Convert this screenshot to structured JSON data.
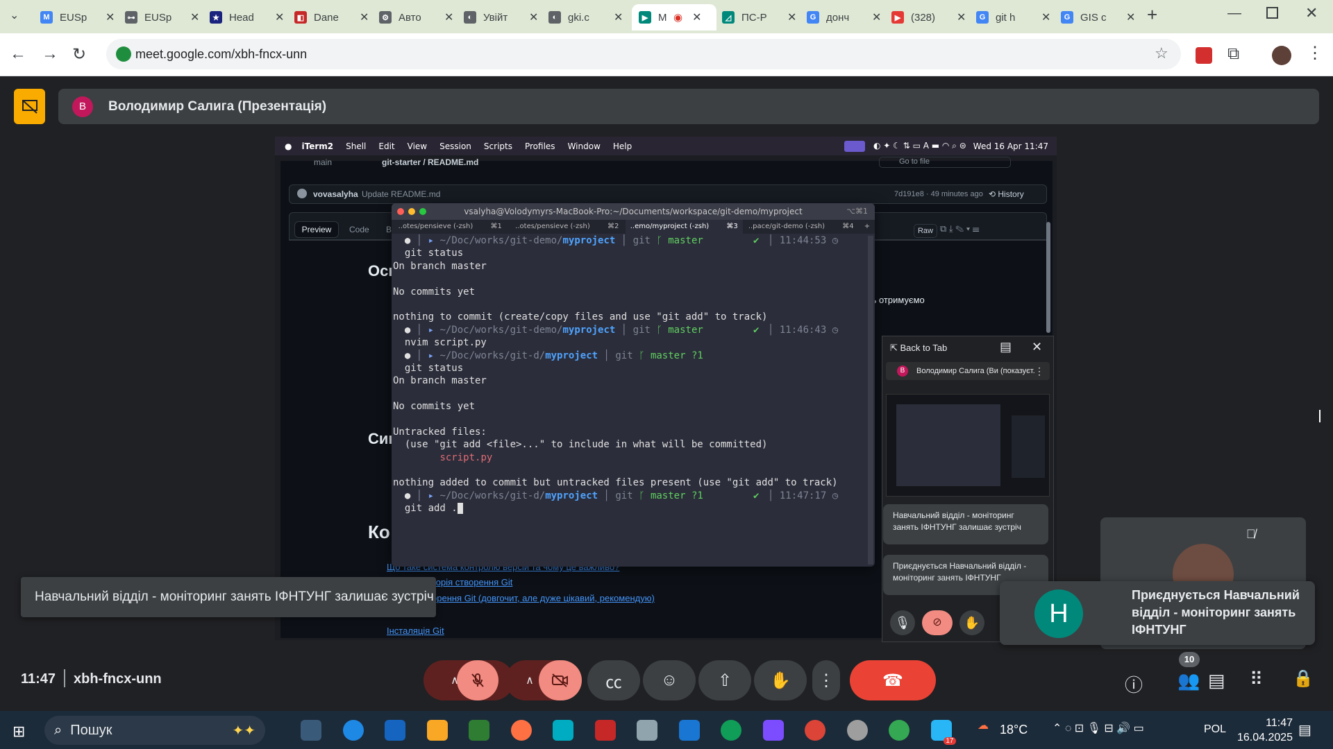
{
  "browser": {
    "tabs": [
      {
        "title": "EUSp",
        "color": "#4285f4",
        "glyph": "M"
      },
      {
        "title": "EUSp",
        "color": "#5f6368",
        "glyph": "⊶"
      },
      {
        "title": "Head",
        "color": "#1a237e",
        "glyph": "★"
      },
      {
        "title": "Dane",
        "color": "#c62828",
        "glyph": "◧"
      },
      {
        "title": "Авто",
        "color": "#5f6368",
        "glyph": "⚙"
      },
      {
        "title": "Увійт",
        "color": "#5f6368",
        "glyph": "◐"
      },
      {
        "title": "gki.c",
        "color": "#5f6368",
        "glyph": "◐"
      },
      {
        "title": "M",
        "color": "#00897b",
        "glyph": "▶"
      },
      {
        "title": "ПС-Р",
        "color": "#00897b",
        "glyph": "◿"
      },
      {
        "title": "донч",
        "color": "#4285f4",
        "glyph": "G"
      },
      {
        "title": "(328)",
        "color": "#e53935",
        "glyph": "▶"
      },
      {
        "title": "git h",
        "color": "#4285f4",
        "glyph": "G"
      },
      {
        "title": "GIS c",
        "color": "#4285f4",
        "glyph": "G"
      }
    ],
    "url": "meet.google.com/xbh-fncx-unn"
  },
  "meet": {
    "presenter_avatar": "В",
    "presenter_title": "Володимир Салига (Презентація)",
    "meeting_time": "11:47",
    "meeting_code": "xbh-fncx-unn",
    "participant_count": "10",
    "leave_toast": "Навчальний відділ - моніторинг занять ІФНТУНГ залишає зустріч",
    "join_avatar": "Н",
    "join_text": "Приєднується Навчальний відділ - моніторинг занять ІФНТУНГ"
  },
  "mac_menu": {
    "app": "iTerm2",
    "items": [
      "Shell",
      "Edit",
      "View",
      "Session",
      "Scripts",
      "Profiles",
      "Window",
      "Help"
    ],
    "clock": "Wed 16 Apr  11:47"
  },
  "github": {
    "branch": "main",
    "path": "git-starter / README.md",
    "author": "vovasalyha",
    "commit_msg": "Update README.md",
    "commit_meta": "7d191e8 · 49 minutes ago",
    "history": "History",
    "tab_preview": "Preview",
    "tab_code": "Code",
    "tab_blame": "B",
    "raw": "Raw",
    "goto_file": "Go to file",
    "heading1": "Осн",
    "heading2": "Син",
    "heading3": "Ко",
    "side_text": "дь отримуємо",
    "links": [
      "Що таке система контролю версій та чому це важливо?",
      "торія створення Git",
      "орення Git (довгочит, але дуже цікавий, рекомендую)",
      "Інсталяція Git"
    ]
  },
  "terminal": {
    "title": "vsalyha@Volodymyrs-MacBook-Pro:~/Documents/workspace/git-demo/myproject",
    "shortcut": "⌥⌘1",
    "tabs": [
      {
        "label": "..otes/pensieve (-zsh)",
        "key": "⌘1"
      },
      {
        "label": "..otes/pensieve (-zsh)",
        "key": "⌘2"
      },
      {
        "label": "..emo/myproject (-zsh)",
        "key": "⌘3"
      },
      {
        "label": "..pace/git-demo (-zsh)",
        "key": "⌘4"
      }
    ],
    "prompt1": {
      "path_dim": "~/Doc/works/git-demo/",
      "path_bold": "myproject",
      "branch": "master",
      "time": "11:44:53"
    },
    "prompt2": {
      "path_dim": "~/Doc/works/git-demo/",
      "path_bold": "myproject",
      "branch": "master",
      "time": "11:46:43"
    },
    "prompt3": {
      "path_dim": "~/Doc/works/git-d/",
      "path_bold": "myproject",
      "branch": "master ?1",
      "time": ""
    },
    "prompt4": {
      "path_dim": "~/Doc/works/git-d/",
      "path_bold": "myproject",
      "branch": "master ?1",
      "time": "11:47:17"
    },
    "git_label": "git",
    "cmd1": "git status",
    "out_branch": "On branch master",
    "out_nocommits": "No commits yet",
    "out_nothing": "nothing to commit (create/copy files and use \"git add\" to track)",
    "cmd2": "nvim script.py",
    "cmd3": "git status",
    "out_branch2": "On branch master",
    "out_nocommits2": "No commits yet",
    "out_untracked": "Untracked files:",
    "out_hint": "  (use \"git add <file>...\" to include in what will be committed)",
    "out_file": "script.py",
    "out_nothing2": "nothing added to commit but untracked files present (use \"git add\" to track)",
    "cmd4": "git add ."
  },
  "pip": {
    "back_to_tab": "Back to Tab",
    "presenter_row": "Володимир Салига (Ви (показуєт...",
    "presenter_avatar": "В",
    "card1": "Навчальний відділ - моніторинг занять ІФНТУНГ залишає зустріч",
    "card2": "Приєднується Навчальний відділ - моніторинг занять ІФНТУНГ"
  },
  "taskbar": {
    "search": "Пошук",
    "temperature": "18°C",
    "language": "POL",
    "time": "11:47",
    "date": "16.04.2025",
    "telegram_badge": "17"
  }
}
